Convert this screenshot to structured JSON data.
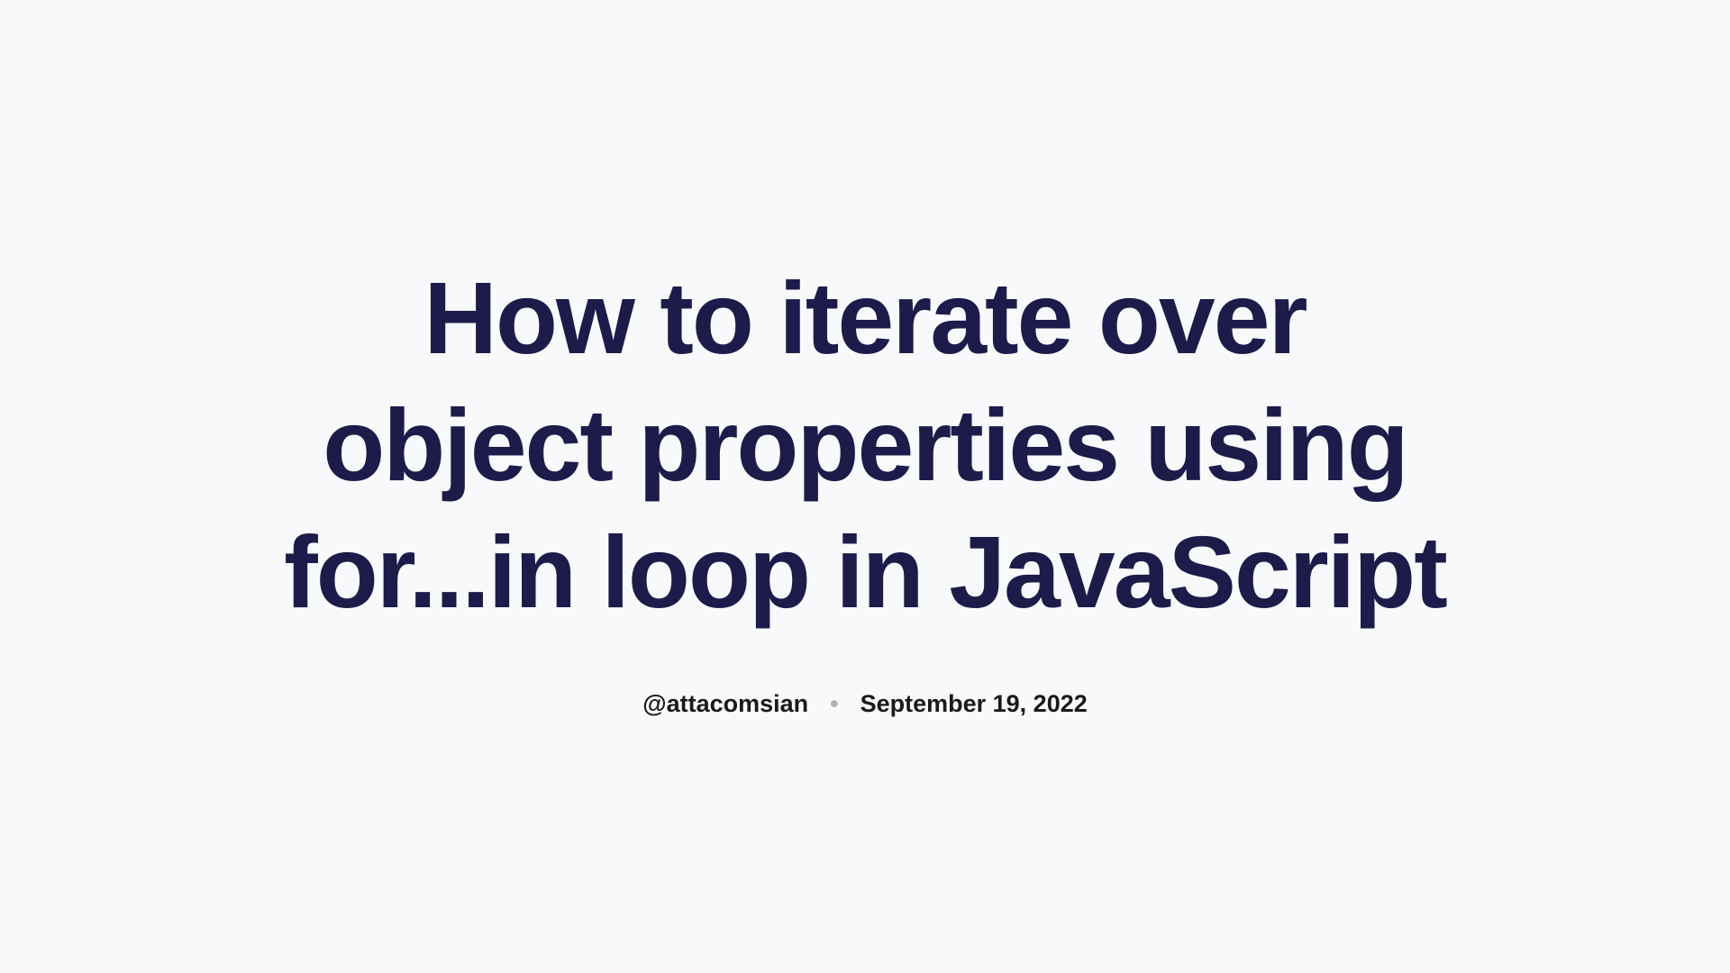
{
  "article": {
    "title": "How to iterate over object properties using for...in loop in JavaScript",
    "author": "@attacomsian",
    "date": "September 19, 2022",
    "separator": "•"
  }
}
